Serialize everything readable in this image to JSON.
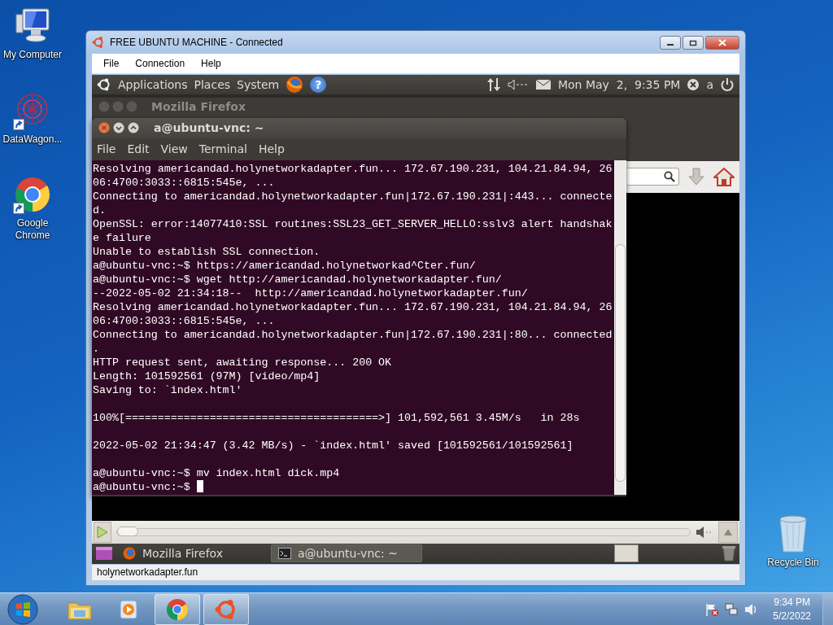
{
  "desktop_icons": [
    {
      "label": "My Computer",
      "kind": "computer",
      "shortcut": false
    },
    {
      "label": "DataWagon...",
      "kind": "app",
      "shortcut": true
    },
    {
      "label": "Google Chrome",
      "kind": "chrome",
      "shortcut": true
    },
    {
      "label": "Recycle Bin",
      "kind": "recycle",
      "shortcut": false
    }
  ],
  "vnc_window": {
    "title": "FREE UBUNTU MACHINE - Connected",
    "menu": [
      "File",
      "Connection",
      "Help"
    ],
    "status": "holynetworkadapter.fun"
  },
  "top_panel": {
    "menus": [
      "Applications",
      "Places",
      "System"
    ],
    "help_glyph": "?",
    "clock": "Mon May  2,  9:35 PM",
    "user": "a"
  },
  "firefox": {
    "title": "Mozilla Firefox",
    "seek": {
      "level": 0
    }
  },
  "terminal": {
    "title": "a@ubuntu-vnc: ~",
    "menu": [
      "File",
      "Edit",
      "View",
      "Terminal",
      "Help"
    ],
    "cursor": true,
    "blocks": [
      [
        "Resolving americandad.holynetworkadapter.fun... 172.67.190.231, 104.21.84.94, 26",
        "06:4700:3033::6815:545e, ...",
        "Connecting to americandad.holynetworkadapter.fun|172.67.190.231|:443... connecte",
        "d.",
        "OpenSSL: error:14077410:SSL routines:SSL23_GET_SERVER_HELLO:sslv3 alert handshak",
        "e failure",
        "Unable to establish SSL connection.",
        "a@ubuntu-vnc:~$ https://americandad.holynetworkad^Cter.fun/",
        "a@ubuntu-vnc:~$ wget http://americandad.holynetworkadapter.fun/",
        "--2022-05-02 21:34:18--  http://americandad.holynetworkadapter.fun/",
        "Resolving americandad.holynetworkadapter.fun... 172.67.190.231, 104.21.84.94, 26",
        "06:4700:3033::6815:545e, ...",
        "Connecting to americandad.holynetworkadapter.fun|172.67.190.231|:80... connected",
        ".",
        "HTTP request sent, awaiting response... 200 OK",
        "Length: 101592561 (97M) [video/mp4]",
        "Saving to: `index.html'"
      ],
      [
        "100%[=======================================>] 101,592,561 3.45M/s   in 28s"
      ],
      [
        "2022-05-02 21:34:47 (3.42 MB/s) - `index.html' saved [101592561/101592561]"
      ],
      [
        "a@ubuntu-vnc:~$ mv index.html dick.mp4",
        "a@ubuntu-vnc:~$ "
      ]
    ]
  },
  "bottom_panel": {
    "tasks": [
      {
        "label": "Mozilla Firefox",
        "kind": "firefox",
        "selected": false
      },
      {
        "label": "a@ubuntu-vnc: ~",
        "kind": "terminal",
        "selected": true
      }
    ]
  },
  "taskbar": {
    "items": [
      {
        "kind": "explorer",
        "running": false
      },
      {
        "kind": "media",
        "running": false
      },
      {
        "kind": "chrome",
        "running": true
      },
      {
        "kind": "ubuntu",
        "running": true
      }
    ],
    "time": "9:34 PM",
    "date": "5/2/2022"
  }
}
